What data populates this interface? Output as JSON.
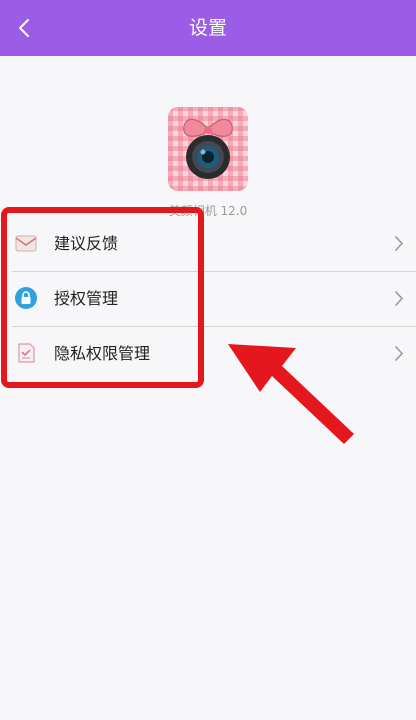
{
  "header": {
    "title": "设置",
    "background": "#9b5de5",
    "back_icon": "chevron-left-icon"
  },
  "app": {
    "icon": "camera-with-bow-icon",
    "version_text": "美颜相机 12.0"
  },
  "settings": {
    "items": [
      {
        "label": "建议反馈",
        "icon": "envelope-icon"
      },
      {
        "label": "授权管理",
        "icon": "lock-icon"
      },
      {
        "label": "隐私权限管理",
        "icon": "document-icon"
      }
    ]
  },
  "annotation": {
    "color": "#e4161e",
    "shapes": [
      "highlight-box",
      "pointer-arrow"
    ]
  }
}
